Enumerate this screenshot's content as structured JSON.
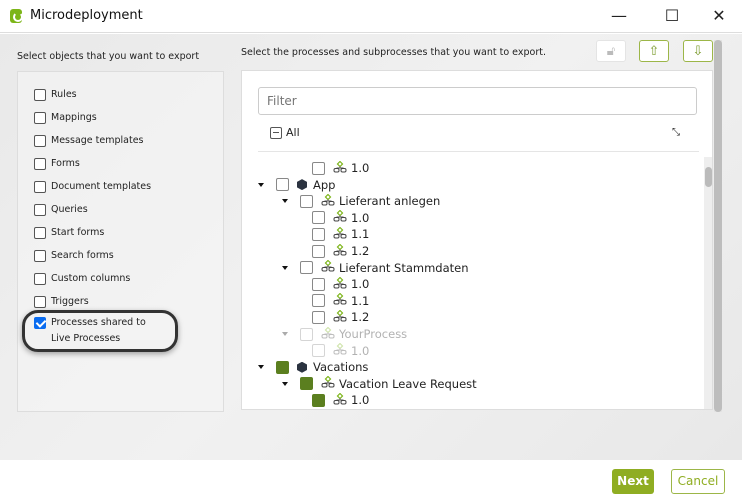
{
  "window": {
    "title": "Microdeployment",
    "minimize": "—",
    "maximize": "☐",
    "close": "✕"
  },
  "left": {
    "heading": "Select objects that you want to export",
    "items": [
      {
        "label": "Rules",
        "checked": false
      },
      {
        "label": "Mappings",
        "checked": false
      },
      {
        "label": "Message templates",
        "checked": false
      },
      {
        "label": "Forms",
        "checked": false
      },
      {
        "label": "Document templates",
        "checked": false
      },
      {
        "label": "Queries",
        "checked": false
      },
      {
        "label": "Start forms",
        "checked": false
      },
      {
        "label": "Search forms",
        "checked": false
      },
      {
        "label": "Custom columns",
        "checked": false
      },
      {
        "label": "Triggers",
        "checked": false
      },
      {
        "label": "Processes shared to Live Processes",
        "checked": true
      }
    ]
  },
  "right": {
    "heading": "Select the processes and subprocesses that you want to export.",
    "filter_placeholder": "Filter",
    "all_label": "All",
    "tree": [
      {
        "label": "1.0",
        "level": 2,
        "type": "version",
        "checked": false
      },
      {
        "label": "App",
        "level": 0,
        "type": "app",
        "checked": false,
        "expanded": true
      },
      {
        "label": "Lieferant anlegen",
        "level": 1,
        "type": "process",
        "checked": false,
        "expanded": true
      },
      {
        "label": "1.0",
        "level": 2,
        "type": "version",
        "checked": false
      },
      {
        "label": "1.1",
        "level": 2,
        "type": "version",
        "checked": false
      },
      {
        "label": "1.2",
        "level": 2,
        "type": "version",
        "checked": false
      },
      {
        "label": "Lieferant Stammdaten",
        "level": 1,
        "type": "process",
        "checked": false,
        "expanded": true
      },
      {
        "label": "1.0",
        "level": 2,
        "type": "version",
        "checked": false
      },
      {
        "label": "1.1",
        "level": 2,
        "type": "version",
        "checked": false
      },
      {
        "label": "1.2",
        "level": 2,
        "type": "version",
        "checked": false
      },
      {
        "label": "YourProcess",
        "level": 1,
        "type": "process",
        "checked": false,
        "expanded": true,
        "disabled": true
      },
      {
        "label": "1.0",
        "level": 2,
        "type": "version",
        "checked": false,
        "disabled": true
      },
      {
        "label": "Vacations",
        "level": 0,
        "type": "app",
        "checked": true,
        "expanded": true
      },
      {
        "label": "Vacation Leave Request",
        "level": 1,
        "type": "process",
        "checked": true,
        "expanded": true
      },
      {
        "label": "1.0",
        "level": 2,
        "type": "version",
        "checked": true
      }
    ]
  },
  "toolbar": {
    "icons": [
      "lock-icon",
      "upload-icon",
      "download-icon"
    ]
  },
  "footer": {
    "next": "Next",
    "cancel": "Cancel"
  },
  "colors": {
    "accent": "#8fad22",
    "checked_green": "#5b7f1f",
    "checked_blue": "#0a6cf0"
  }
}
